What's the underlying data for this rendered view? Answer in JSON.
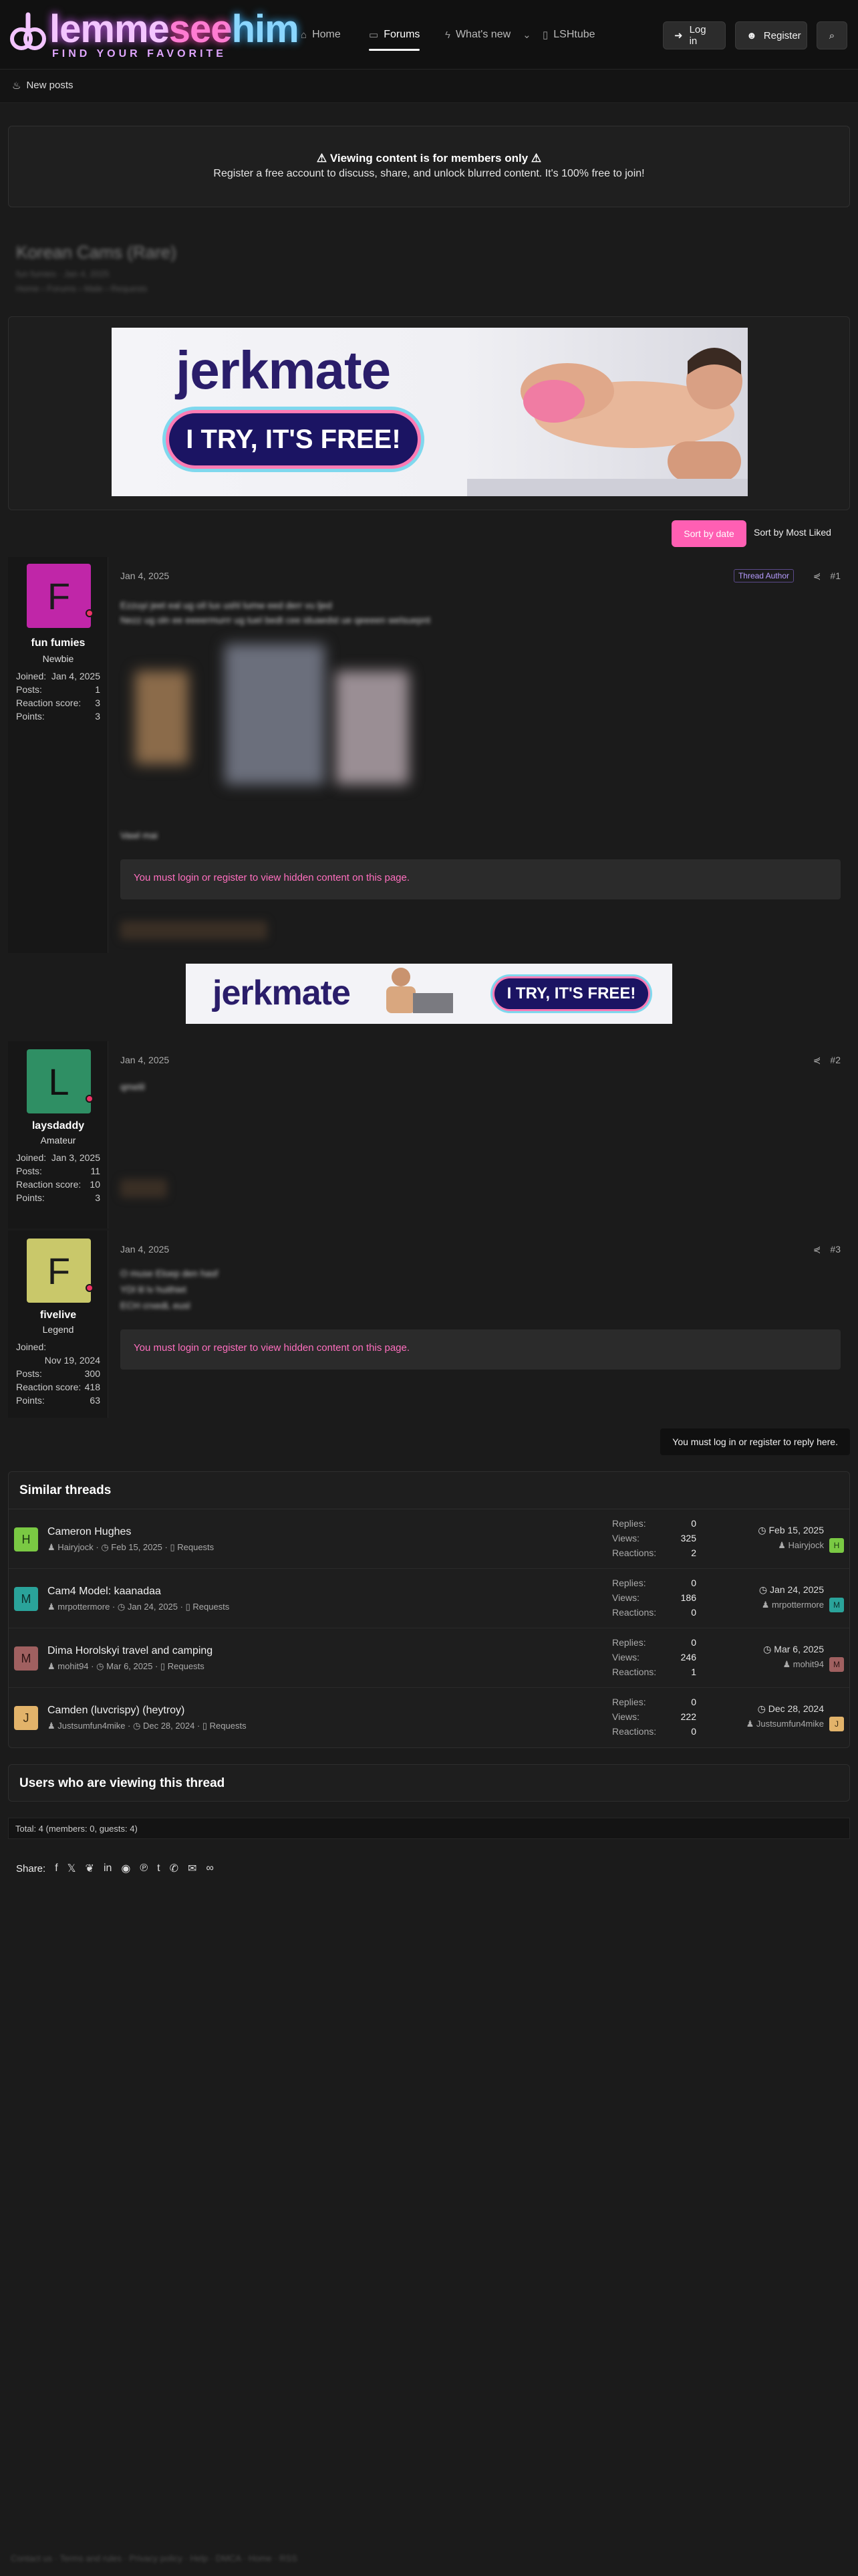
{
  "header": {
    "logo_part1": "lemme",
    "logo_part2": "see",
    "logo_part3": "him",
    "logo_tagline": "FIND YOUR FAVORITE",
    "nav": [
      {
        "label": "Home",
        "icon": "home-icon"
      },
      {
        "label": "Forums",
        "icon": "forums-icon"
      },
      {
        "label": "What's new",
        "icon": "bolt-icon"
      },
      {
        "label": "LSHtube",
        "icon": "video-icon"
      }
    ],
    "login_label": "Log in",
    "register_label": "Register"
  },
  "subnav": {
    "new_posts_label": "New posts"
  },
  "notice": {
    "title": "⚠ Viewing content is for members only ⚠",
    "body": "Register a free account to discuss, share, and unlock blurred content. It's 100% free to join!"
  },
  "thread": {
    "title": "Korean Cams (Rare)",
    "meta": "fun fumies · Jan 4, 2025",
    "breadcrumbs": "Home › Forums › Male › Requests"
  },
  "ads": {
    "brand": "jerkmate",
    "cta": "I TRY, IT'S FREE!"
  },
  "sort": {
    "active": "Sort by date",
    "other": "Sort by Most Liked"
  },
  "hidden_notice": "You must login or register to view hidden content on this page.",
  "posts": [
    {
      "avatar_letter": "F",
      "avatar_color": "#c026a8",
      "username": "fun fumies",
      "role": "Newbie",
      "joined_label": "Joined:",
      "joined": "Jan 4, 2025",
      "posts_label": "Posts:",
      "posts": "1",
      "reaction_label": "Reaction score:",
      "reaction": "3",
      "points_label": "Points:",
      "points": "3",
      "date": "Jan 4, 2025",
      "number": "#1",
      "thread_author_label": "Thread Author",
      "text_line1": "Ezzuyi jeet eal ug oIl lux ushl lumw eed derr vu ljed",
      "text_line2": "Nezz ug oln ee eeeermurrr ug tuel bedt cee iduaedst ue qeeeen welsuepnt",
      "text_line3": "Vawl mai"
    },
    {
      "avatar_letter": "L",
      "avatar_color": "#2f8f64",
      "username": "laysdaddy",
      "role": "Amateur",
      "joined_label": "Joined:",
      "joined": "Jan 3, 2025",
      "posts_label": "Posts:",
      "posts": "11",
      "reaction_label": "Reaction score:",
      "reaction": "10",
      "points_label": "Points:",
      "points": "3",
      "date": "Jan 4, 2025",
      "number": "#2",
      "text_line1": "qmelil"
    },
    {
      "avatar_letter": "F",
      "avatar_color": "#c9c86a",
      "username": "fivelive",
      "role": "Legend",
      "joined_label": "Joined:",
      "joined": "Nov 19, 2024",
      "posts_label": "Posts:",
      "posts": "300",
      "reaction_label": "Reaction score:",
      "reaction": "418",
      "points_label": "Points:",
      "points": "63",
      "date": "Jan 4, 2025",
      "number": "#3",
      "text_line1": "O muse Eloep den hasf",
      "text_line2": "YDl lil lv huithiet",
      "text_line3": "ECH crxedL eusl"
    }
  ],
  "reply_note": "You must log in or register to reply here.",
  "similar": {
    "heading": "Similar threads",
    "replies_label": "Replies:",
    "views_label": "Views:",
    "reactions_label": "Reactions:",
    "threads": [
      {
        "letter": "H",
        "color": "#7ac943",
        "title": "Cameron Hughes",
        "author": "Hairyjock",
        "date": "Feb 15, 2025",
        "forum": "Requests",
        "replies": "0",
        "views": "325",
        "reactions": "2",
        "last_date": "Feb 15, 2025",
        "last_user": "Hairyjock"
      },
      {
        "letter": "M",
        "color": "#2aa39a",
        "title": "Cam4 Model: kaanadaa",
        "author": "mrpottermore",
        "date": "Jan 24, 2025",
        "forum": "Requests",
        "replies": "0",
        "views": "186",
        "reactions": "0",
        "last_date": "Jan 24, 2025",
        "last_user": "mrpottermore"
      },
      {
        "letter": "M",
        "color": "#a06060",
        "title": "Dima Horolskyi travel and camping",
        "author": "mohit94",
        "date": "Mar 6, 2025",
        "forum": "Requests",
        "replies": "0",
        "views": "246",
        "reactions": "1",
        "last_date": "Mar 6, 2025",
        "last_user": "mohit94"
      },
      {
        "letter": "J",
        "color": "#e2b36a",
        "title": "Camden (luvcrispy) (heytroy)",
        "author": "Justsumfun4mike",
        "date": "Dec 28, 2024",
        "forum": "Requests",
        "replies": "0",
        "views": "222",
        "reactions": "0",
        "last_date": "Dec 28, 2024",
        "last_user": "Justsumfun4mike"
      }
    ]
  },
  "viewing": {
    "heading": "Users who are viewing this thread",
    "total": "Total: 4 (members: 0, guests: 4)"
  },
  "share": {
    "label": "Share:"
  },
  "footer": {
    "links": "Contact us  ·  Terms and rules  ·  Privacy policy  ·  Help  ·  DMCA  ·  Home  ·  RSS"
  }
}
